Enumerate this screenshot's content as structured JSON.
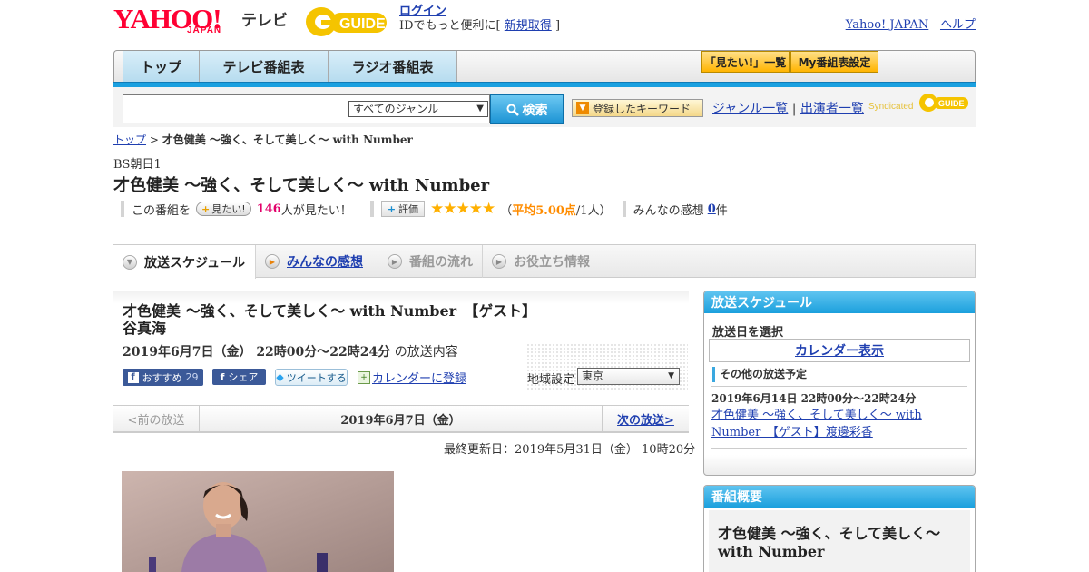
{
  "header": {
    "logo_yahoo": "YAHOO!",
    "logo_japan": "JAPAN",
    "logo_tv": "テレビ",
    "logo_guide": "GUIDE",
    "login_label": "ログイン",
    "login_note_prefix": "IDでもっと便利に[",
    "signup_label": "新規取得",
    "login_note_suffix": "]",
    "yahoo_japan_link": "Yahoo! JAPAN",
    "separator": "-",
    "help_link": "ヘルプ"
  },
  "nav": {
    "tabs": [
      "トップ",
      "テレビ番組表",
      "ラジオ番組表"
    ],
    "mitai_list": "「見たい!」一覧",
    "my_schedule": "My番組表設定"
  },
  "search": {
    "genre_selected": "すべてのジャンル",
    "button_label": "検索",
    "keyword_button": "登録したキーワード",
    "genre_list_link": "ジャンル一覧",
    "divider": "|",
    "cast_list_link": "出演者一覧",
    "syndicated": "Syndicated"
  },
  "breadcrumb": {
    "top": "トップ",
    "sep": ">",
    "current": "才色健美 ～強く、そして美しく～ with Number"
  },
  "program": {
    "channel": "BS朝日1",
    "title": "才色健美 ～強く、そして美しく～ with Number",
    "this_program": "この番組を",
    "mitai_btn": "見たい!",
    "mitai_count": "146",
    "mitai_suffix": "人が見たい！",
    "hyoka_btn": "評価",
    "stars": "★★★★★",
    "avg_prefix": "（",
    "avg_label": "平均5.00点",
    "avg_suffix": "/1人）",
    "reviews_label": "みんなの感想",
    "reviews_count": "0",
    "reviews_suffix": "件"
  },
  "content_tabs": [
    "放送スケジュール",
    "みんなの感想",
    "番組の流れ",
    "お役立ち情報"
  ],
  "episode": {
    "title": "才色健美 ～強く、そして美しく～ with Number　【ゲスト】谷真海",
    "date": "2019年6月7日（金） 22時00分～22時24分",
    "date_suffix": "の放送内容",
    "fb_recommend": "おすすめ",
    "fb_count": "29",
    "fb_share": "シェア",
    "tweet": "ツイートする",
    "calendar_register": "カレンダーに登録",
    "region_label": "地域設定",
    "region_value": "東京",
    "prev": "<前の放送",
    "pager_date": "2019年6月7日（金）",
    "next": "次の放送>",
    "updated": "最終更新日：2019年5月31日（金） 10時20分"
  },
  "sidebar": {
    "schedule_head": "放送スケジュール",
    "select_date": "放送日を選択",
    "calendar_btn": "カレンダー表示",
    "other_head": "その他の放送予定",
    "other_date": "2019年6月14日 22時00分～22時24分",
    "other_title": "才色健美 ～強く、そして美しく～ with Number　【ゲスト】渡邊彩香",
    "overview_head": "番組概要",
    "overview_title": "才色健美 ～強く、そして美しく～ with Number"
  },
  "colors": {
    "yahoo_red": "#ff0033",
    "accent_blue": "#1aa0e0",
    "link": "#1f3fb0",
    "star": "#ffb000",
    "count_pink": "#e2006a"
  }
}
